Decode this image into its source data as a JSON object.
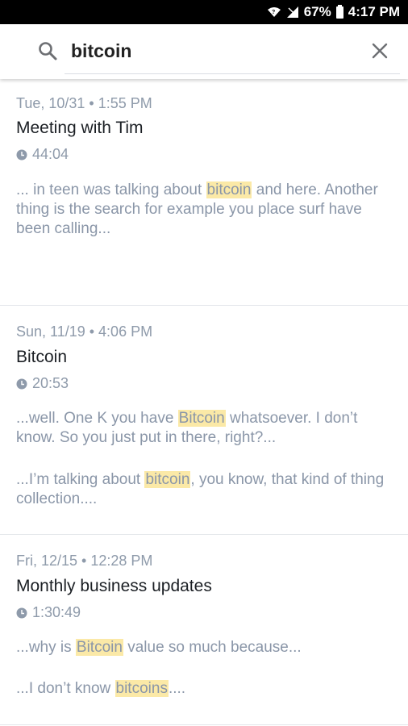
{
  "status_bar": {
    "battery": "67%",
    "time": "4:17 PM"
  },
  "search": {
    "query": "bitcoin",
    "placeholder": ""
  },
  "results": [
    {
      "date": "Tue, 10/31 • 1:55 PM",
      "title": "Meeting with Tim",
      "duration": "44:04",
      "snippets": [
        {
          "pre": "... in teen was talking about ",
          "hl": "bitcoin",
          "post": " and here. Another thing is the search for example you place surf have been calling..."
        }
      ]
    },
    {
      "date": "Sun, 11/19 • 4:06 PM",
      "title": "Bitcoin",
      "duration": "20:53",
      "snippets": [
        {
          "pre": "...well. One K you have ",
          "hl": "Bitcoin",
          "post": " whatsoever. I don’t know. So you just put in there, right?..."
        },
        {
          "pre": "...I’m talking about ",
          "hl": "bitcoin",
          "post": ", you know, that kind of thing collection...."
        }
      ]
    },
    {
      "date": "Fri, 12/15 • 12:28 PM",
      "title": "Monthly business updates",
      "duration": "1:30:49",
      "snippets": [
        {
          "pre": "...why is ",
          "hl": "Bitcoin",
          "post": " value so much because..."
        },
        {
          "pre": "...I don’t know ",
          "hl": "bitcoins",
          "post": "...."
        }
      ]
    }
  ]
}
